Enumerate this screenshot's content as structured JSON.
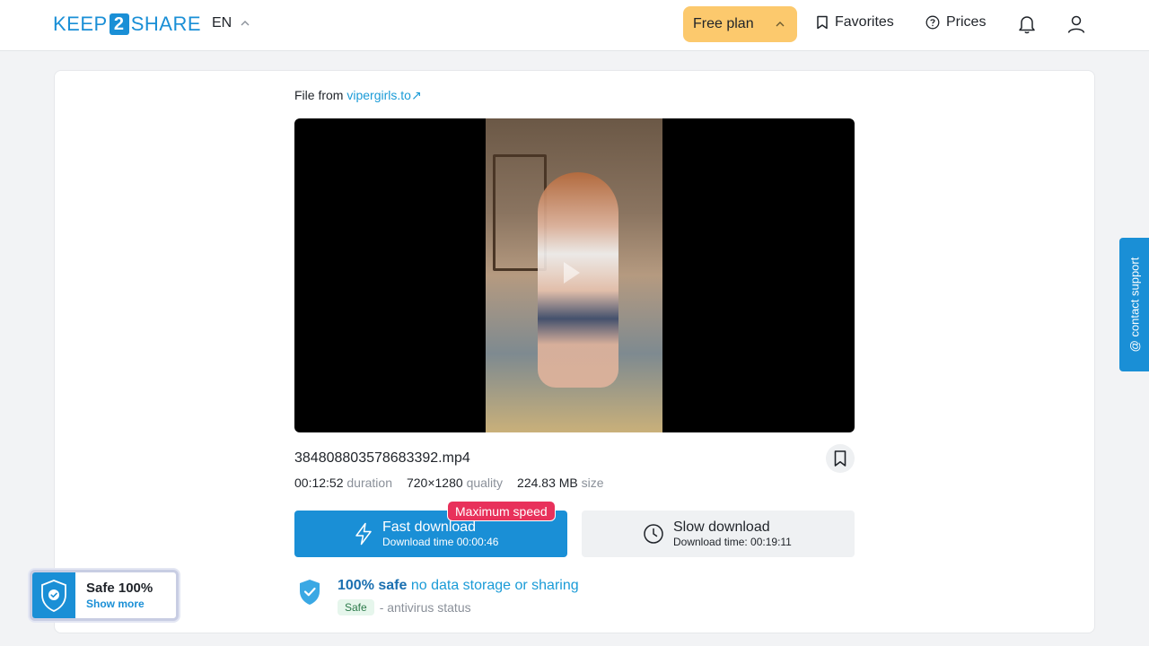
{
  "header": {
    "logo": {
      "part1": "KEEP",
      "part2": "2",
      "part3": "SHARE"
    },
    "lang": "EN",
    "free_plan": "Free plan",
    "favorites": "Favorites",
    "prices": "Prices",
    "icons": [
      "bookmark-icon",
      "question-circle-icon",
      "bell-icon",
      "user-icon",
      "chevron-up-icon"
    ]
  },
  "file": {
    "from_label": "File from",
    "source": "vipergirls.to",
    "source_arrow": "↗",
    "name": "384808803578683392.mp4",
    "duration": "00:12:52",
    "duration_label": "duration",
    "quality": "720×1280",
    "quality_label": "quality",
    "size": "224.83 MB",
    "size_label": "size"
  },
  "download": {
    "badge": "Maximum speed",
    "fast_title": "Fast download",
    "fast_time": "Download time 00:00:46",
    "slow_title": "Slow download",
    "slow_time": "Download time: 00:19:11"
  },
  "safety": {
    "strong": "100% safe",
    "rest": "no data storage or sharing",
    "pill": "Safe",
    "status": "- antivirus status"
  },
  "widget": {
    "title": "Safe 100%",
    "link": "Show more"
  },
  "contact": "@ contact support",
  "colors": {
    "brand": "#1a8fd6",
    "free_plan": "#fcc96d",
    "badge": "#e8315b"
  }
}
